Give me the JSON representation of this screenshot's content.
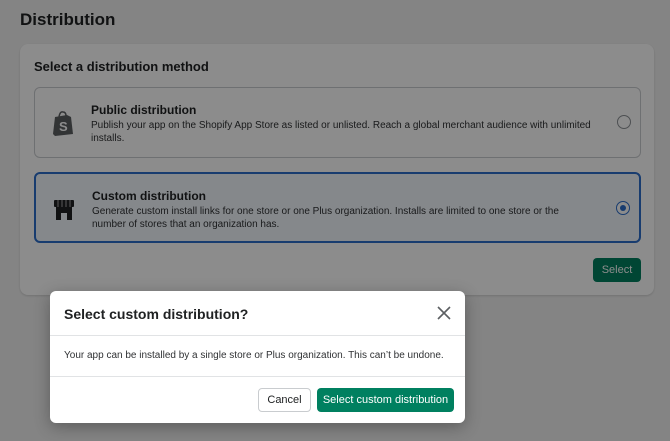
{
  "page": {
    "title": "Distribution"
  },
  "card": {
    "heading": "Select a distribution method",
    "options": [
      {
        "title": "Public distribution",
        "description": "Publish your app on the Shopify App Store as listed or unlisted. Reach a global merchant audience with unlimited installs.",
        "icon": "shopify-bag-icon",
        "selected": false
      },
      {
        "title": "Custom distribution",
        "description": "Generate custom install links for one store or one Plus organization. Installs are limited to one store or the number of stores that an organization has.",
        "icon": "storefront-icon",
        "selected": true
      }
    ],
    "select_label": "Select"
  },
  "modal": {
    "title": "Select custom distribution?",
    "body": "Your app can be installed by a single store or Plus organization. This can’t be undone.",
    "cancel_label": "Cancel",
    "confirm_label": "Select custom distribution"
  },
  "colors": {
    "primary": "#008060",
    "selected": "#2c6ecb"
  }
}
